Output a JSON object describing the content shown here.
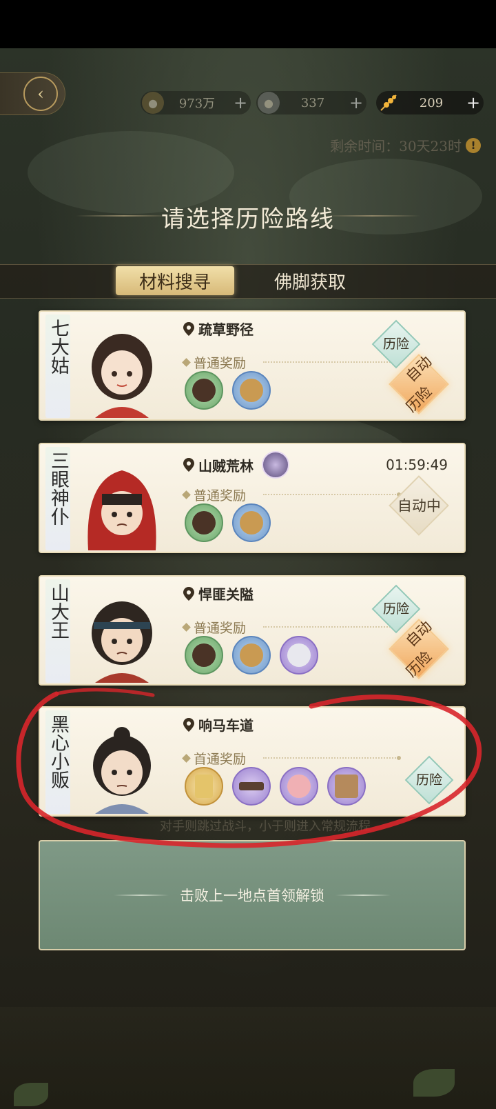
{
  "header": {
    "back_icon": "back-arrow-icon",
    "resources": [
      {
        "name": "copper-coin",
        "icon": "coin-icon",
        "value": "973万",
        "plus": "+"
      },
      {
        "name": "silver",
        "icon": "silver-icon",
        "value": "337",
        "plus": "+"
      },
      {
        "name": "skewer",
        "icon": "skewer-icon",
        "value": "209",
        "plus": "+"
      }
    ],
    "remaining_time": "剩余时间：30天23时"
  },
  "title": "请选择历险路线",
  "tabs": [
    {
      "label": "材料搜寻",
      "active": true
    },
    {
      "label": "佛脚获取",
      "active": false
    }
  ],
  "routes": [
    {
      "character": "七大姑",
      "location": "疏草野径",
      "reward_label": "普通奖励",
      "items": [
        "green",
        "blue"
      ],
      "adventure_label": "历险",
      "auto_label_1": "自动",
      "auto_label_2": "历险"
    },
    {
      "character": "三眼神仆",
      "location": "山贼荒林",
      "reward_label": "普通奖励",
      "items": [
        "green",
        "blue"
      ],
      "timer": "01:59:49",
      "auto_status": "自动中"
    },
    {
      "character": "山大王",
      "location": "悍匪关隘",
      "reward_label": "普通奖励",
      "items": [
        "green",
        "blue",
        "purple"
      ],
      "adventure_label": "历险",
      "auto_label_1": "自动",
      "auto_label_2": "历险"
    },
    {
      "character": "黑心小贩",
      "location": "响马车道",
      "reward_label": "首通奖励",
      "items": [
        "gold",
        "purple",
        "purple",
        "purple"
      ],
      "adventure_label": "历险"
    }
  ],
  "hint_text": "对手则跳过战斗，小于则进入常规流程",
  "locked": {
    "text": "击败上一地点首领解锁"
  },
  "colors": {
    "accent_gold": "#d7b978",
    "annotation_red": "#d8262b",
    "panel_cream": "#fbf6ea"
  }
}
